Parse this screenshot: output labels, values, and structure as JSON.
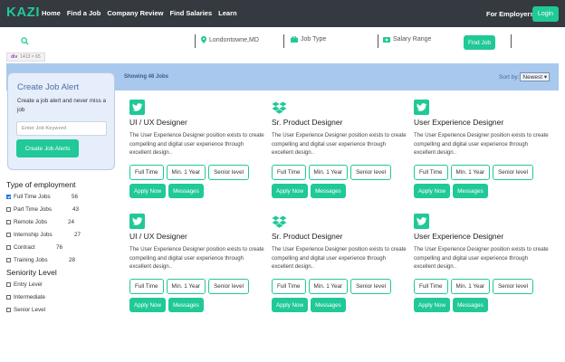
{
  "navbar": {
    "brand": "KAZI",
    "links": [
      "Home",
      "Find a Job",
      "Company Review",
      "Find Salaries",
      "Learn"
    ],
    "employers": "For Employers",
    "login": "Login"
  },
  "search": {
    "location": "Londontowne,MD",
    "job_type": "Job Type",
    "salary": "Salary Range",
    "find_button": "Find Job"
  },
  "devtip": {
    "tag": "div",
    "size": "1413 × 65"
  },
  "results": {
    "showing": "Showing 46 Jobs",
    "sort_label": "Sort by:",
    "sort_value": "Newest"
  },
  "alert": {
    "title": "Create Job Alert",
    "text": "Create a job alert and never miss a job",
    "placeholder": "Enter Job Keyword",
    "button": "Create Job Alerts"
  },
  "filters": {
    "employment_heading": "Type of employment",
    "employment": [
      {
        "label": "Full Time Jobs",
        "count": "56",
        "checked": true
      },
      {
        "label": "Part Time Jobs",
        "count": "43",
        "checked": false
      },
      {
        "label": "Remote Jobs",
        "count": "24",
        "checked": false
      },
      {
        "label": "Internship Jobs",
        "count": "27",
        "checked": false
      },
      {
        "label": "Contract",
        "count": "76",
        "checked": false
      },
      {
        "label": "Training Jobs",
        "count": "28",
        "checked": false
      }
    ],
    "seniority_heading": "Seniority Level",
    "seniority": [
      {
        "label": "Entry Level"
      },
      {
        "label": "Intermediate"
      },
      {
        "label": "Senior Level"
      }
    ]
  },
  "jobs": [
    {
      "logo": "twitter-icon",
      "title": "UI / UX Designer",
      "desc": "The User Experience Designer position exists to create compelling and digital user experience through excellent design..",
      "tags": [
        "Full Time",
        "Min. 1 Year",
        "Senior level"
      ],
      "apply": "Apply Now",
      "messages": "Messages"
    },
    {
      "logo": "dropbox-icon",
      "title": "Sr. Product Designer",
      "desc": "The User Experience Designer position exists to create compelling and digital user experience through excellent design..",
      "tags": [
        "Full Time",
        "Min. 1 Year",
        "Senior level"
      ],
      "apply": "Apply Now",
      "messages": "Messages"
    },
    {
      "logo": "twitter-icon",
      "title": "User Experience Designer",
      "desc": "The User Experience Designer position exists to create compelling and digital user experience through excellent design..",
      "tags": [
        "Full Time",
        "Min. 1 Year",
        "Senior level"
      ],
      "apply": "Apply Now",
      "messages": "Messages"
    },
    {
      "logo": "twitter-icon",
      "title": "UI / UX Designer",
      "desc": "The User Experience Designer position exists to create compelling and digital user experience through excellent design..",
      "tags": [
        "Full Time",
        "Min. 1 Year",
        "Senior level"
      ],
      "apply": "Apply Now",
      "messages": "Messages"
    },
    {
      "logo": "dropbox-icon",
      "title": "Sr. Product Designer",
      "desc": "The User Experience Designer position exists to create compelling and digital user experience through excellent design..",
      "tags": [
        "Full Time",
        "Min. 1 Year",
        "Senior level"
      ],
      "apply": "Apply Now",
      "messages": "Messages"
    },
    {
      "logo": "twitter-icon",
      "title": "User Experience Designer",
      "desc": "The User Experience Designer position exists to create compelling and digital user experience through excellent design..",
      "tags": [
        "Full Time",
        "Min. 1 Year",
        "Senior level"
      ],
      "apply": "Apply Now",
      "messages": "Messages"
    }
  ],
  "colors": {
    "accent": "#20c997",
    "navbar": "#343a40",
    "strip": "#a9c8ee",
    "twitter": "#20c997"
  }
}
